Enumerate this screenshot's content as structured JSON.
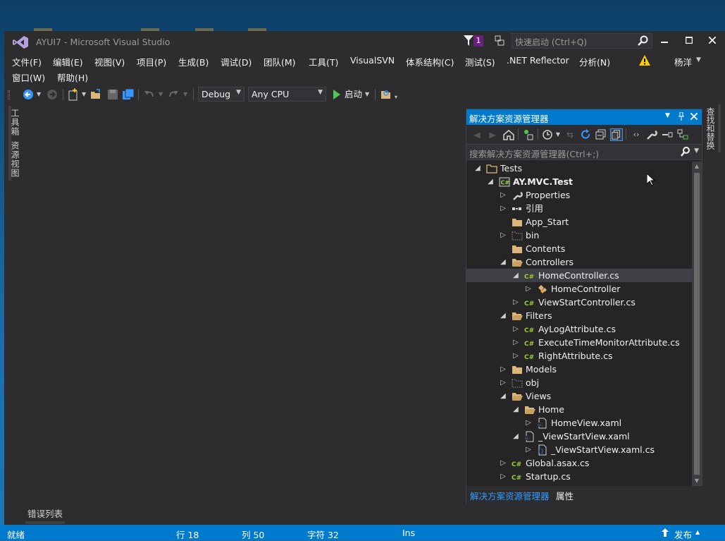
{
  "window": {
    "title": "AYUI7 - Microsoft Visual Studio"
  },
  "titlebar": {
    "notification_count": "1",
    "quick_launch_placeholder": "快速启动 (Ctrl+Q)"
  },
  "menu": [
    "文件(F)",
    "编辑(E)",
    "视图(V)",
    "项目(P)",
    "生成(B)",
    "调试(D)",
    "团队(M)",
    "工具(T)",
    "VisualSVN",
    "体系结构(C)",
    "测试(S)",
    ".NET Reflector",
    "分析(N)"
  ],
  "menu_row2": [
    "窗口(W)",
    "帮助(H)"
  ],
  "user": {
    "name": "杨洋"
  },
  "toolbar": {
    "config": "Debug",
    "platform": "Any CPU",
    "start_label": "启动"
  },
  "left_tabs": [
    "工具箱",
    "资源视图"
  ],
  "right_tab": "查找和替换",
  "bottom_tab": "错误列表",
  "solution_explorer": {
    "title": "解决方案资源管理器",
    "search_placeholder": "搜索解决方案资源管理器(Ctrl+;)",
    "tree": [
      {
        "label": "Tests",
        "icon": "solution-folder-icon",
        "expander": "expanded",
        "level": 0
      },
      {
        "label": "AY.MVC.Test",
        "icon": "csharp-project-icon",
        "expander": "expanded",
        "level": 1,
        "bold": true
      },
      {
        "label": "Properties",
        "icon": "wrench-icon",
        "expander": "collapsed",
        "level": 2
      },
      {
        "label": "引用",
        "icon": "references-icon",
        "expander": "collapsed",
        "level": 2
      },
      {
        "label": "App_Start",
        "icon": "folder-icon",
        "expander": "none",
        "level": 2
      },
      {
        "label": "bin",
        "icon": "dashed-folder-icon",
        "expander": "collapsed",
        "level": 2
      },
      {
        "label": "Contents",
        "icon": "folder-icon",
        "expander": "none",
        "level": 2
      },
      {
        "label": "Controllers",
        "icon": "open-folder-icon",
        "expander": "expanded",
        "level": 2
      },
      {
        "label": "HomeController.cs",
        "icon": "csharp-file-icon",
        "expander": "expanded",
        "level": 3,
        "selected": true
      },
      {
        "label": "HomeController",
        "icon": "class-icon",
        "expander": "collapsed",
        "level": 4
      },
      {
        "label": "ViewStartController.cs",
        "icon": "csharp-file-icon",
        "expander": "collapsed",
        "level": 3
      },
      {
        "label": "Filters",
        "icon": "open-folder-icon",
        "expander": "expanded",
        "level": 2
      },
      {
        "label": "AyLogAttribute.cs",
        "icon": "csharp-file-icon",
        "expander": "collapsed",
        "level": 3
      },
      {
        "label": "ExecuteTimeMonitorAttribute.cs",
        "icon": "csharp-file-icon",
        "expander": "collapsed",
        "level": 3
      },
      {
        "label": "RightAttribute.cs",
        "icon": "csharp-file-icon",
        "expander": "collapsed",
        "level": 3
      },
      {
        "label": "Models",
        "icon": "folder-icon",
        "expander": "collapsed",
        "level": 2
      },
      {
        "label": "obj",
        "icon": "dashed-folder-icon",
        "expander": "collapsed",
        "level": 2
      },
      {
        "label": "Views",
        "icon": "open-folder-icon",
        "expander": "expanded",
        "level": 2
      },
      {
        "label": "Home",
        "icon": "open-folder-icon",
        "expander": "expanded",
        "level": 3
      },
      {
        "label": "HomeView.xaml",
        "icon": "xaml-file-icon",
        "expander": "collapsed",
        "level": 4
      },
      {
        "label": "_ViewStartView.xaml",
        "icon": "xaml-file-icon",
        "expander": "expanded",
        "level": 3
      },
      {
        "label": "_ViewStartView.xaml.cs",
        "icon": "code-behind-icon",
        "expander": "collapsed",
        "level": 4
      },
      {
        "label": "Global.asax.cs",
        "icon": "csharp-file-icon",
        "expander": "collapsed",
        "level": 2
      },
      {
        "label": "Startup.cs",
        "icon": "csharp-file-icon",
        "expander": "collapsed",
        "level": 2
      }
    ],
    "bottom_tabs": [
      "解决方案资源管理器",
      "属性"
    ]
  },
  "status": {
    "state": "就绪",
    "line": "行 18",
    "col": "列 50",
    "char": "字符 32",
    "mode": "Ins",
    "publish": "发布"
  },
  "colors": {
    "accent": "#007acc",
    "background": "#2d2d30",
    "panel": "#252526",
    "csharp": "#9acd32",
    "folder": "#dcb67a"
  }
}
